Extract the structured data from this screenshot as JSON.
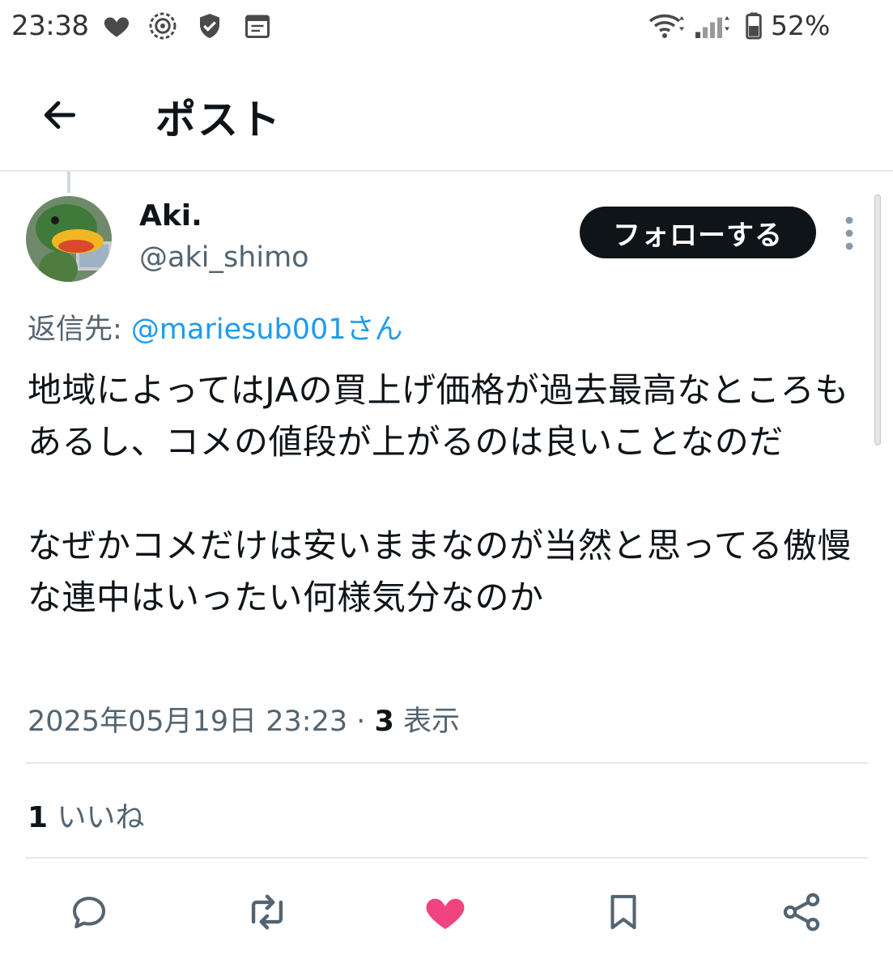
{
  "status_bar": {
    "time": "23:38",
    "battery_percent": "52%",
    "left_icons": [
      "heart-icon",
      "hotspot-icon",
      "shield-check-icon",
      "calendar-icon"
    ],
    "right_icons": [
      "wifi-icon",
      "signal-icon",
      "battery-icon"
    ]
  },
  "header": {
    "title": "ポスト",
    "back_icon": "arrow-left-icon"
  },
  "post": {
    "author": {
      "name": "Aki.",
      "handle": "@aki_shimo",
      "avatar_icon": "avatar-duck-puppet"
    },
    "follow_label": "フォローする",
    "reply_prefix": "返信先: ",
    "reply_handle": "@mariesub001さん",
    "text": "地域によってはJAの買上げ価格が過去最高なところもあるし、コメの値段が上がるのは良いことなのだ\n\nなぜかコメだけは安いままなのが当然と思ってる傲慢な連中はいったい何様気分なのか",
    "timestamp": "2025年05月19日 23:23",
    "separator": " · ",
    "views_count": "3",
    "views_label": " 表示",
    "likes_count": "1",
    "likes_label": " いいね"
  },
  "actions": [
    "reply-icon",
    "retweet-icon",
    "like-icon",
    "bookmark-icon",
    "share-icon"
  ],
  "colors": {
    "text_primary": "#0f1419",
    "text_secondary": "#536471",
    "link": "#1d9bf0",
    "like_active": "#f0437f",
    "follow_bg": "#0f1419"
  }
}
